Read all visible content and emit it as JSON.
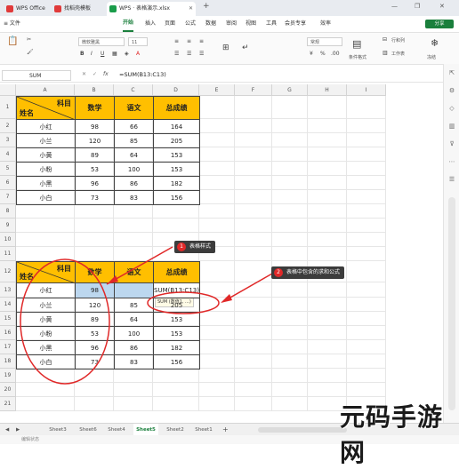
{
  "titlebar": {
    "tabs": [
      {
        "label": "WPS Office",
        "icon": "wps-logo-icon",
        "color": "#e03a3a"
      },
      {
        "label": "找稻壳模板",
        "icon": "docer-icon",
        "color": "#e03a3a"
      },
      {
        "label": "WPS · 表格演示.xlsx",
        "icon": "spreadsheet-icon",
        "color": "#1a9c4a"
      }
    ],
    "new_tab": "+",
    "window_controls": {
      "minimize": "—",
      "maximize": "❐",
      "close": "✕"
    }
  },
  "menubar": {
    "file": "≡ 文件",
    "items": [
      "开始",
      "插入",
      "页面",
      "公式",
      "数据",
      "审阅",
      "视图",
      "工具",
      "会员专享",
      "效率"
    ],
    "active": "开始",
    "share": "分享"
  },
  "ribbon": {
    "font_name": "微软雅黑",
    "font_size": "11",
    "number_format": "常规",
    "row_col": "行和列",
    "worksheet": "工作表",
    "conditional": "条件格式",
    "freeze": "冻结"
  },
  "formula_bar": {
    "cell_ref": "SUM",
    "fx": "fx",
    "formula": "=SUM(B13:C13)"
  },
  "columns": [
    "A",
    "B",
    "C",
    "D",
    "E",
    "F",
    "G",
    "H",
    "I"
  ],
  "rows": [
    "1",
    "2",
    "3",
    "4",
    "5",
    "6",
    "7",
    "8",
    "9",
    "10",
    "11",
    "12",
    "13",
    "14",
    "15",
    "16",
    "17",
    "18",
    "19",
    "20",
    "21"
  ],
  "table1": {
    "header_subject": "科目",
    "header_name": "姓名",
    "headers": [
      "数学",
      "语文",
      "总成绩"
    ],
    "data": [
      [
        "小红",
        "98",
        "66",
        "164"
      ],
      [
        "小兰",
        "120",
        "85",
        "205"
      ],
      [
        "小黄",
        "89",
        "64",
        "153"
      ],
      [
        "小粉",
        "53",
        "100",
        "153"
      ],
      [
        "小黑",
        "96",
        "86",
        "182"
      ],
      [
        "小白",
        "73",
        "83",
        "156"
      ]
    ]
  },
  "table2": {
    "header_subject": "科目",
    "header_name": "姓名",
    "headers": [
      "数学",
      "语文",
      "总成绩"
    ],
    "first_row": [
      "小红",
      "98",
      "",
      "SUM(B13:C13)"
    ],
    "data": [
      [
        "小兰",
        "120",
        "85",
        "205"
      ],
      [
        "小黄",
        "89",
        "64",
        "153"
      ],
      [
        "小粉",
        "53",
        "100",
        "153"
      ],
      [
        "小黑",
        "96",
        "86",
        "182"
      ],
      [
        "小白",
        "73",
        "83",
        "156"
      ]
    ],
    "tooltip": "SUM (数值1, ...)"
  },
  "annotations": [
    {
      "number": "1",
      "text": "表格样式"
    },
    {
      "number": "2",
      "text": "表格中包含的求和公式"
    }
  ],
  "sheets": {
    "items": [
      "Sheet3",
      "Sheet6",
      "Sheet4",
      "Sheet5",
      "Sheet2",
      "Sheet1"
    ],
    "active": "Sheet5",
    "nav": [
      "◀",
      "▶"
    ],
    "add": "+"
  },
  "statusbar": {
    "mode": "编辑状态"
  },
  "watermark": "元码手游网",
  "colors": {
    "header_fill": "#ffbf00",
    "accent": "#1a7f3c",
    "annotation": "#e02828",
    "callout_bg": "#3c3c3c",
    "selected_cell": "#bcd7ef"
  }
}
